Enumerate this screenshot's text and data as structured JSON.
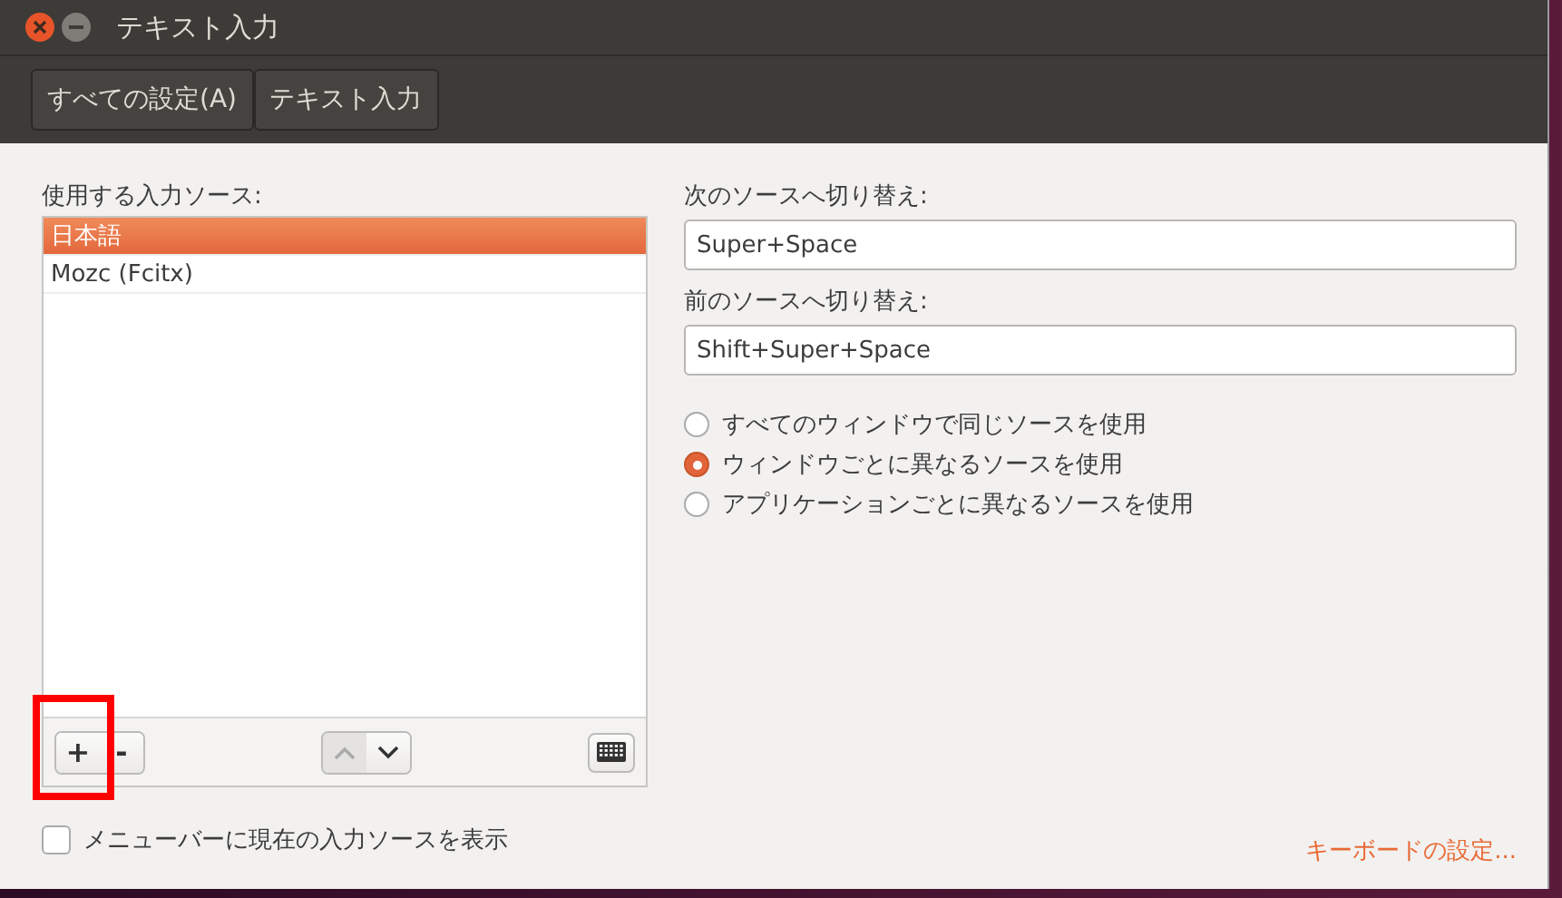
{
  "window": {
    "title": "テキスト入力"
  },
  "breadcrumbs": [
    {
      "label": "すべての設定(A)"
    },
    {
      "label": "テキスト入力"
    }
  ],
  "sources": {
    "label": "使用する入力ソース:",
    "items": [
      {
        "name": "日本語",
        "selected": true
      },
      {
        "name": "Mozc (Fcitx)",
        "selected": false
      }
    ],
    "add": "+",
    "remove": "-",
    "move_up": {
      "disabled": true
    },
    "move_down": {
      "disabled": false
    }
  },
  "next_source": {
    "label": "次のソースへ切り替え:",
    "value": "Super+Space"
  },
  "prev_source": {
    "label": "前のソースへ切り替え:",
    "value": "Shift+Super+Space"
  },
  "modes": [
    {
      "label": "すべてのウィンドウで同じソースを使用",
      "selected": false
    },
    {
      "label": "ウィンドウごとに異なるソースを使用",
      "selected": true
    },
    {
      "label": "アプリケーションごとに異なるソースを使用",
      "selected": false
    }
  ],
  "show_in_menubar": {
    "label": "メニューバーに現在の入力ソースを表示",
    "checked": false
  },
  "keyboard_settings": "キーボードの設定..."
}
